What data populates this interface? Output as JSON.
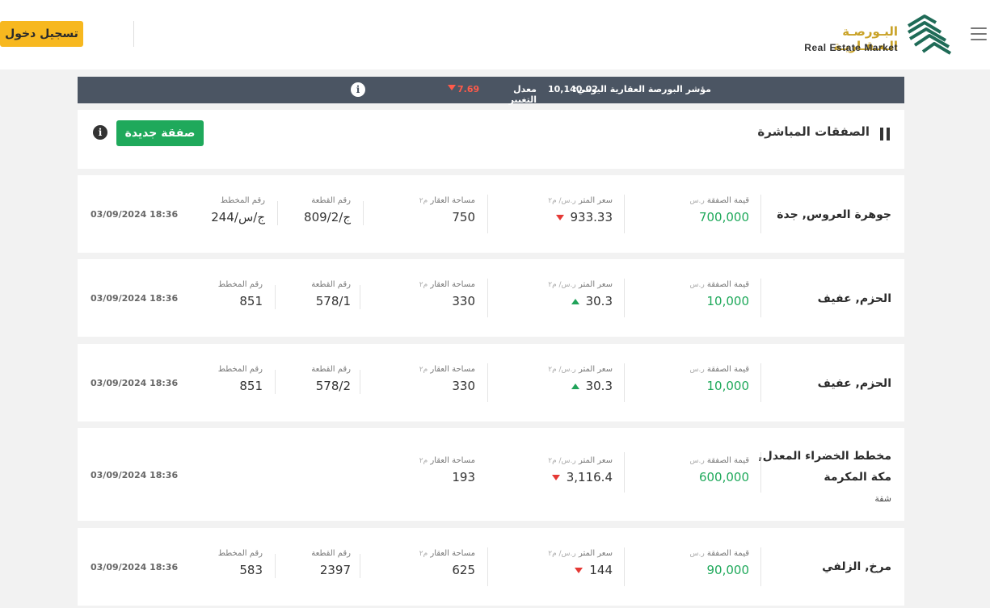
{
  "header": {
    "logo_ar": "البـورصـة الـعـقـاريـة",
    "logo_en": "Real Estate Market",
    "login_label": "تسجيل دخول"
  },
  "index_bar": {
    "index_label": "مؤشر البورصة العقارية اليومي:",
    "index_value": "10,140.02",
    "change_label": "معدل التغيير",
    "change_value": "7.69",
    "change_direction": "down"
  },
  "section": {
    "title": "الصفقات المباشرة",
    "new_deal_label": "صفقة جديدة"
  },
  "labels": {
    "deal_value": "قيمة الصفقة",
    "deal_value_unit": "ر.س",
    "meter_price": "سعر المتر",
    "meter_price_unit": "ر.س/ م٢",
    "area": "مساحة العقار",
    "area_unit": "م٢",
    "plot_no": "رقم القطعة",
    "plan_no": "رقم المخطط"
  },
  "deals": [
    {
      "location": "جوهرة العروس, جدة",
      "value": "700,000",
      "meter_price": "933.33",
      "trend": "down",
      "area": "750",
      "plot_no": "809/2/ج",
      "plan_no": "244/ج/س",
      "datetime": "03/09/2024 18:36"
    },
    {
      "location": "الحزم, عفيف",
      "value": "10,000",
      "meter_price": "30.3",
      "trend": "up",
      "area": "330",
      "plot_no": "578/1",
      "plan_no": "851",
      "datetime": "03/09/2024 18:36"
    },
    {
      "location": "الحزم, عفيف",
      "value": "10,000",
      "meter_price": "30.3",
      "trend": "up",
      "area": "330",
      "plot_no": "578/2",
      "plan_no": "851",
      "datetime": "03/09/2024 18:36"
    },
    {
      "location_line1": "مخطط الخضراء المعدل,",
      "location_line2": "مكة المكرمة",
      "property_type": "شقة",
      "value": "600,000",
      "meter_price": "3,116.4",
      "trend": "down",
      "area": "193",
      "datetime": "03/09/2024 18:36"
    },
    {
      "location": "مرخ, الزلفي",
      "value": "90,000",
      "meter_price": "144",
      "trend": "down",
      "area": "625",
      "plot_no": "2397",
      "plan_no": "583",
      "datetime": "03/09/2024 18:36"
    }
  ],
  "colors": {
    "accent_green": "#1fa95b",
    "login_yellow": "#f7b81f",
    "index_bar": "#4b5563",
    "down_red": "#e53935",
    "logo_gold": "#c9a227",
    "logo_green": "#1f6b57"
  }
}
